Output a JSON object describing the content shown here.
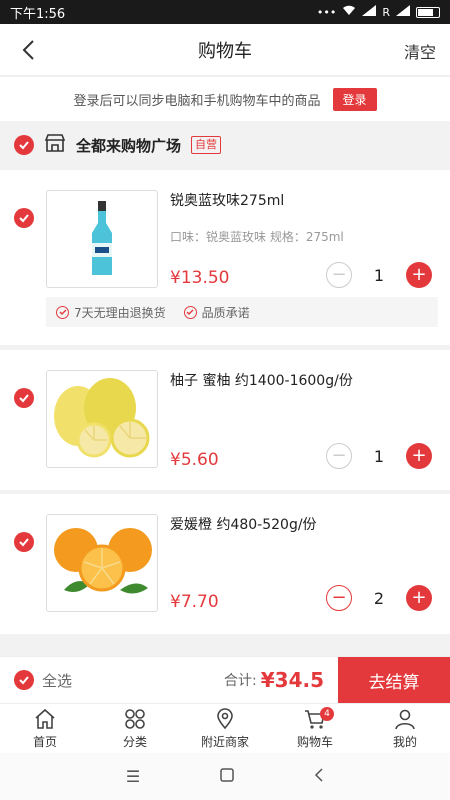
{
  "status": {
    "time": "下午1:56",
    "dots": "•••",
    "extra": "R"
  },
  "nav": {
    "title": "购物车",
    "clear_label": "清空"
  },
  "login": {
    "message": "登录后可以同步电脑和手机购物车中的商品",
    "button_label": "登录"
  },
  "store": {
    "name": "全都来购物广场",
    "tag": "自营"
  },
  "items": [
    {
      "name": "锐奥蓝玫味275ml",
      "spec": "口味：锐奥蓝玫味 规格：275ml",
      "price": "¥13.50",
      "qty": "1"
    },
    {
      "name": "柚子 蜜柚 约1400-1600g/份",
      "price": "¥5.60",
      "qty": "1"
    },
    {
      "name": "爱媛橙 约480-520g/份",
      "price": "¥7.70",
      "qty": "2"
    }
  ],
  "promises": [
    "7天无理由退换货",
    "品质承诺"
  ],
  "checkout": {
    "select_all": "全选",
    "total_label": "合计:",
    "total_value": "¥34.5",
    "pay_label": "去结算"
  },
  "tabs": [
    {
      "label": "首页",
      "icon": "home-icon"
    },
    {
      "label": "分类",
      "icon": "category-icon"
    },
    {
      "label": "附近商家",
      "icon": "location-icon"
    },
    {
      "label": "购物车",
      "icon": "cart-icon",
      "badge": "4"
    },
    {
      "label": "我的",
      "icon": "user-icon"
    }
  ],
  "colors": {
    "accent": "#e4393c"
  }
}
